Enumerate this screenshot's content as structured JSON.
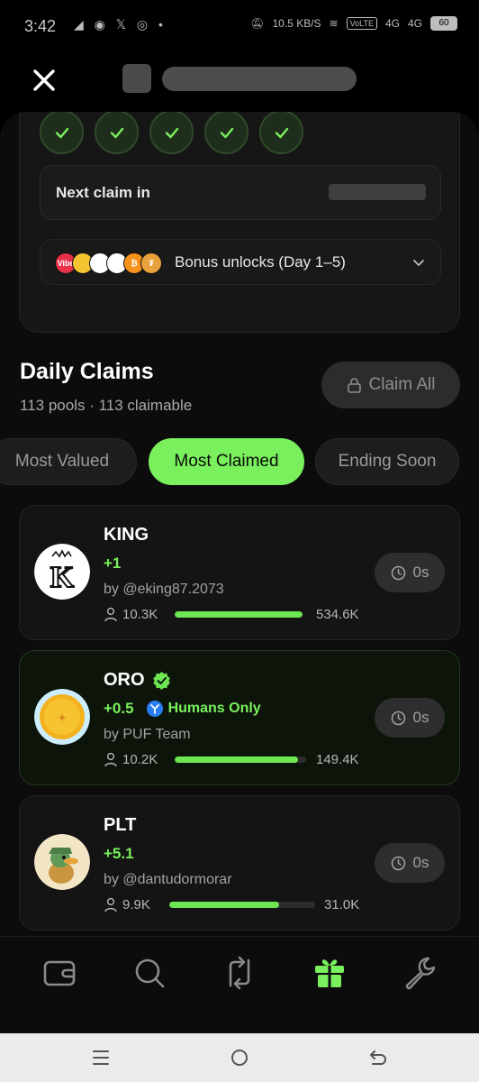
{
  "status_bar": {
    "time": "3:42",
    "left_icons": "◢ ◉ 𝕏 ◎ •",
    "network_speed": "10.5 KB/S",
    "volte": "VoLTE",
    "signal1": "4G",
    "signal2": "4G",
    "battery": "60"
  },
  "claim_card": {
    "checks_count": 5,
    "next_claim_label": "Next claim in",
    "bonus_label": "Bonus unlocks (Day 1–5)",
    "bonus_coin_labels": [
      "Vibe",
      "",
      "",
      "",
      "₿",
      "₮"
    ]
  },
  "section": {
    "title": "Daily Claims",
    "subtitle": "113 pools · 113 claimable",
    "claim_all_label": "Claim All"
  },
  "filters": [
    {
      "label": "Most Valued",
      "active": false
    },
    {
      "label": "Most Claimed",
      "active": true
    },
    {
      "label": "Ending Soon",
      "active": false
    }
  ],
  "pools": [
    {
      "name": "KING",
      "amount": "+1",
      "by": "by @eking87.2073",
      "claimers": "10.3K",
      "total": "534.6K",
      "progress": 1.0,
      "timer": "0s",
      "verified": false,
      "humans_only": "",
      "avatar_letter": "K"
    },
    {
      "name": "ORO",
      "amount": "+0.5",
      "by": "by PUF Team",
      "claimers": "10.2K",
      "total": "149.4K",
      "progress": 0.94,
      "timer": "0s",
      "verified": true,
      "humans_only": "Humans Only",
      "avatar_letter": ""
    },
    {
      "name": "PLT",
      "amount": "+5.1",
      "by": "by @dantudormorar",
      "claimers": "9.9K",
      "total": "31.0K",
      "progress": 0.75,
      "timer": "0s",
      "verified": false,
      "humans_only": "",
      "avatar_letter": ""
    }
  ],
  "nav": {
    "items": [
      "wallet-icon",
      "search-icon",
      "swap-icon",
      "gift-icon",
      "wrench-icon"
    ],
    "active": "gift-icon",
    "accent": "#79f05c"
  }
}
